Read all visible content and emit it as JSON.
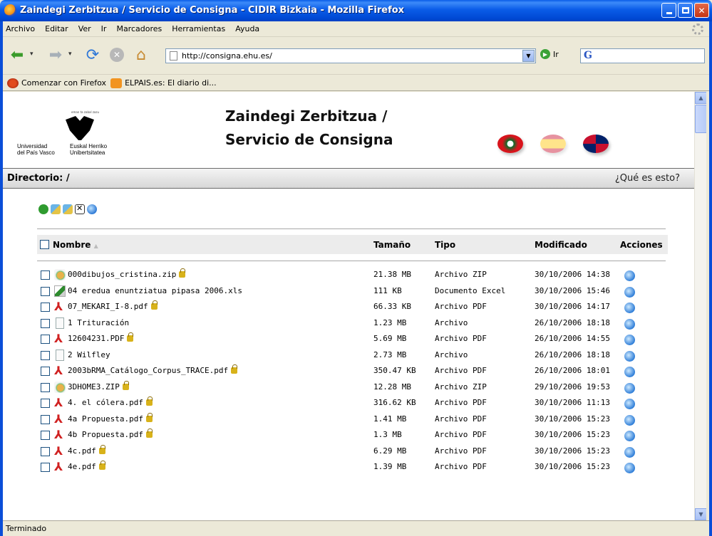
{
  "window": {
    "title": "Zaindegi Zerbitzua / Servicio de Consigna - CIDIR Bizkaia - Mozilla Firefox"
  },
  "menu": [
    "Archivo",
    "Editar",
    "Ver",
    "Ir",
    "Marcadores",
    "Herramientas",
    "Ayuda"
  ],
  "nav": {
    "url": "http://consigna.ehu.es/",
    "go_label": "Ir",
    "search_logo": "G"
  },
  "bookmarks": [
    {
      "label": "Comenzar con Firefox",
      "icon": "firefox-icon"
    },
    {
      "label": "ELPAIS.es: El diario di...",
      "icon": "rss-feed-icon"
    }
  ],
  "site": {
    "logo_motto": "eman ta zabal zazu",
    "logo_line1_left": "Universidad",
    "logo_line2_left": "del País Vasco",
    "logo_line1_right": "Euskal Herriko",
    "logo_line2_right": "Unibertsitatea",
    "title_line1": "Zaindegi Zerbitzua /",
    "title_line2": "Servicio de Consigna",
    "directory": "Directorio: /",
    "what_is_this": "¿Qué es esto?"
  },
  "table": {
    "headers": {
      "name": "Nombre",
      "sort_arrow": "▲",
      "size": "Tamaño",
      "type": "Tipo",
      "modified": "Modificado",
      "actions": "Acciones"
    },
    "rows": [
      {
        "name": "000dibujos_cristina.zip",
        "icon": "zip-icon",
        "locked": true,
        "size": "21.38 MB",
        "type": "Archivo ZIP",
        "modified": "30/10/2006 14:38"
      },
      {
        "name": "04 eredua enuntziatua pipasa 2006.xls",
        "icon": "excel-icon",
        "locked": false,
        "size": "111 KB",
        "type": "Documento Excel",
        "modified": "30/10/2006 15:46"
      },
      {
        "name": "07_MEKARI_I-8.pdf",
        "icon": "pdf-icon",
        "locked": true,
        "size": "66.33 KB",
        "type": "Archivo PDF",
        "modified": "30/10/2006 14:17"
      },
      {
        "name": "1 Trituración",
        "icon": "file-icon",
        "locked": false,
        "size": "1.23 MB",
        "type": "Archivo",
        "modified": "26/10/2006 18:18"
      },
      {
        "name": "12604231.PDF",
        "icon": "pdf-icon",
        "locked": true,
        "size": "5.69 MB",
        "type": "Archivo PDF",
        "modified": "26/10/2006 14:55"
      },
      {
        "name": "2 Wilfley",
        "icon": "file-icon",
        "locked": false,
        "size": "2.73 MB",
        "type": "Archivo",
        "modified": "26/10/2006 18:18"
      },
      {
        "name": "2003bRMA_Catálogo_Corpus_TRACE.pdf",
        "icon": "pdf-icon",
        "locked": true,
        "size": "350.47 KB",
        "type": "Archivo PDF",
        "modified": "26/10/2006 18:01"
      },
      {
        "name": "3DHOME3.ZIP",
        "icon": "zip-icon",
        "locked": true,
        "size": "12.28 MB",
        "type": "Archivo ZIP",
        "modified": "29/10/2006 19:53"
      },
      {
        "name": "4. el cólera.pdf",
        "icon": "pdf-icon",
        "locked": true,
        "size": "316.62 KB",
        "type": "Archivo PDF",
        "modified": "30/10/2006 11:13"
      },
      {
        "name": "4a Propuesta.pdf",
        "icon": "pdf-icon",
        "locked": true,
        "size": "1.41 MB",
        "type": "Archivo PDF",
        "modified": "30/10/2006 15:23"
      },
      {
        "name": "4b Propuesta.pdf",
        "icon": "pdf-icon",
        "locked": true,
        "size": "1.3 MB",
        "type": "Archivo PDF",
        "modified": "30/10/2006 15:23"
      },
      {
        "name": "4c.pdf",
        "icon": "pdf-icon",
        "locked": true,
        "size": "6.29 MB",
        "type": "Archivo PDF",
        "modified": "30/10/2006 15:23"
      },
      {
        "name": "4e.pdf",
        "icon": "pdf-icon",
        "locked": true,
        "size": "1.39 MB",
        "type": "Archivo PDF",
        "modified": "30/10/2006 15:23"
      }
    ]
  },
  "status": "Terminado",
  "colors": {
    "titlebar": "#0a5ce8",
    "dirbar": "#d7d7d7",
    "header_row": "#ececec"
  }
}
